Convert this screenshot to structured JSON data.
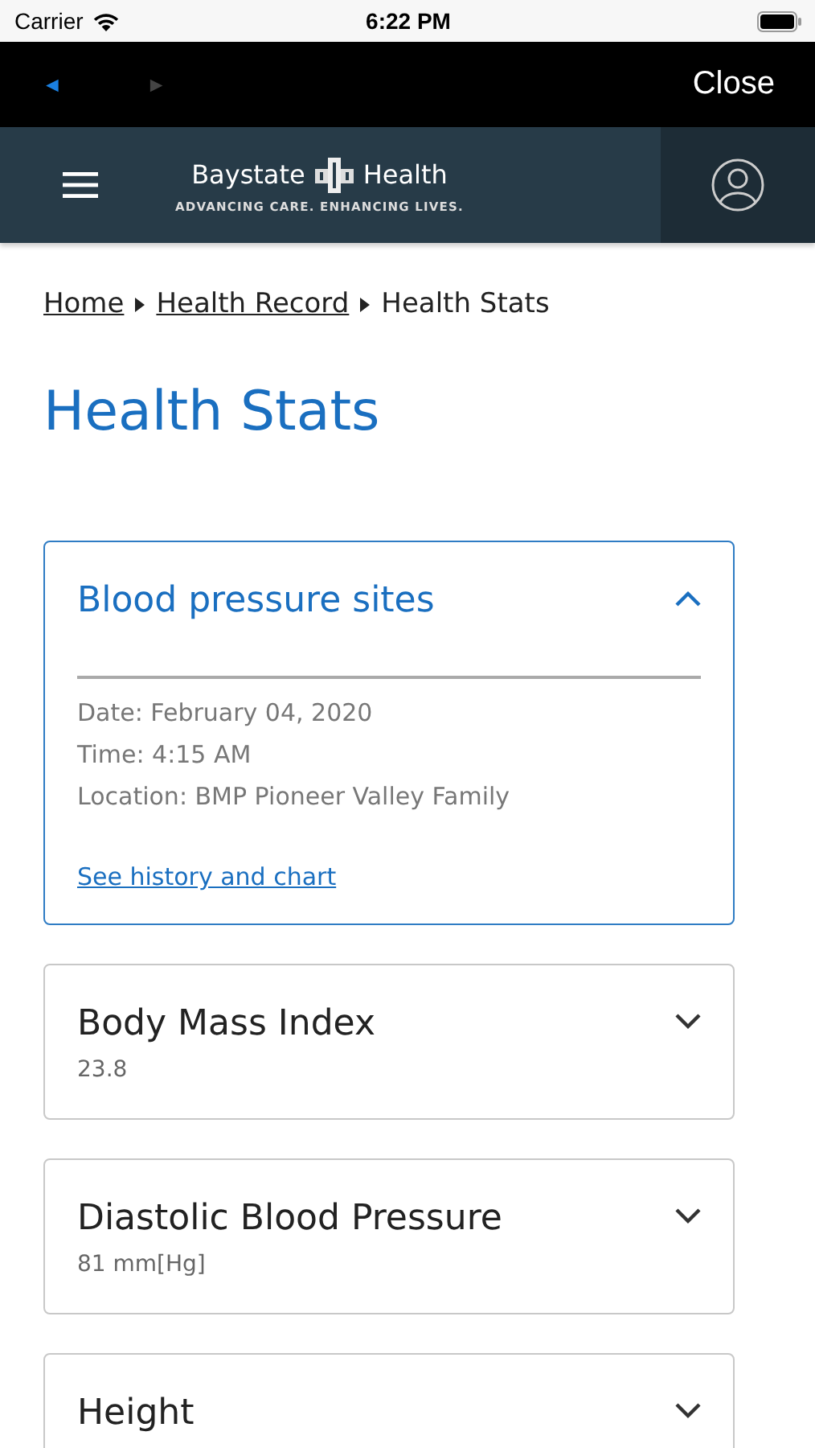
{
  "status_bar": {
    "carrier": "Carrier",
    "time": "6:22 PM"
  },
  "browser_bar": {
    "back": {
      "symbol": "◄",
      "disabled": false
    },
    "forward": {
      "symbol": "►",
      "disabled": true
    },
    "close": "Close"
  },
  "header": {
    "brand_left": "Baystate",
    "brand_right": "Health",
    "tagline": "ADVANCING CARE. ENHANCING LIVES."
  },
  "breadcrumb": [
    {
      "label": "Home",
      "link": true
    },
    {
      "label": "Health Record",
      "link": true
    },
    {
      "label": "Health Stats",
      "link": false
    }
  ],
  "page_title": "Health Stats",
  "cards": [
    {
      "title": "Blood pressure sites",
      "expanded": true,
      "details": [
        "Date: February 04, 2020",
        "Time: 4:15 AM",
        "Location: BMP Pioneer Valley Family"
      ],
      "link": "See history and chart"
    },
    {
      "title": "Body Mass Index",
      "expanded": false,
      "value": "23.8"
    },
    {
      "title": "Diastolic Blood Pressure",
      "expanded": false,
      "value": "81 mm[Hg]"
    },
    {
      "title": "Height",
      "expanded": false
    }
  ]
}
